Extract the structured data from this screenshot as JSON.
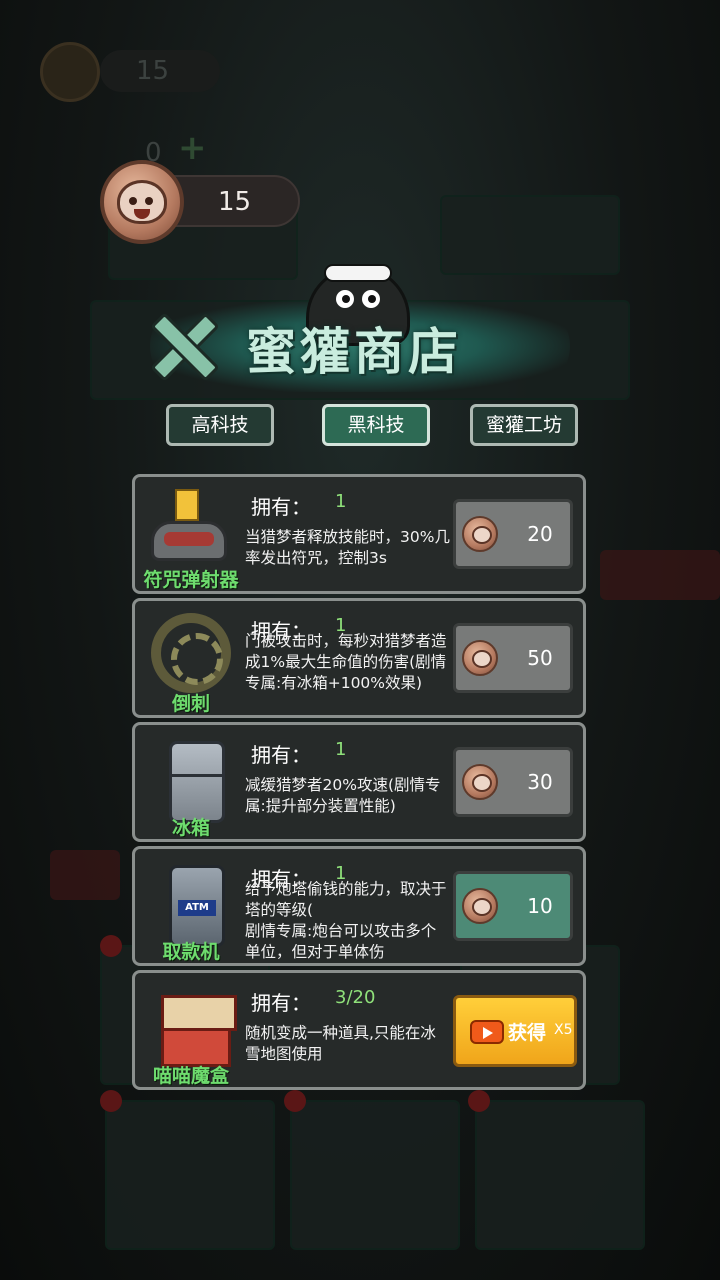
{
  "header": {
    "bg_coin_count": "15",
    "bg_zero_count": "0",
    "coin_count": "15"
  },
  "title": "蜜獾商店",
  "tabs": [
    {
      "label": "高科技",
      "active": false
    },
    {
      "label": "黑科技",
      "active": true
    },
    {
      "label": "蜜獾工坊",
      "active": false
    }
  ],
  "items": [
    {
      "name": "符咒弹射器",
      "owned_label": "拥有：",
      "owned": "1",
      "desc": "当猎梦者释放技能时，30%几率发出符咒，控制3s",
      "price": "20",
      "affordable": false
    },
    {
      "name": "倒刺",
      "owned_label": "拥有：",
      "owned": "1",
      "desc": "门被攻击时，每秒对猎梦者造成1%最大生命值的伤害(剧情专属:有冰箱+100%效果)",
      "price": "50",
      "affordable": false
    },
    {
      "name": "冰箱",
      "owned_label": "拥有：",
      "owned": "1",
      "desc": "减缓猎梦者20%攻速(剧情专属:提升部分装置性能)",
      "price": "30",
      "affordable": false
    },
    {
      "name": "取款机",
      "owned_label": "拥有：",
      "owned": "1",
      "desc": "给予炮塔偷钱的能力，取决于塔的等级(\n剧情专属:炮台可以攻击多个单位，但对于单体伤",
      "price": "10",
      "affordable": true,
      "icon_text": "ATM"
    },
    {
      "name": "喵喵魔盒",
      "owned_label": "拥有：",
      "owned": "3/20",
      "desc": "随机变成一种道具,只能在冰雪地图使用",
      "get_label": "获得",
      "get_multiplier": "X5"
    }
  ],
  "colors": {
    "name_green": "#6edc6e",
    "owned_green": "#8fe07a",
    "tab_active": "#2d6a54",
    "price_gray": "#787a79",
    "price_green": "#4d8a76",
    "get_yellow": "#ffcf3a"
  }
}
